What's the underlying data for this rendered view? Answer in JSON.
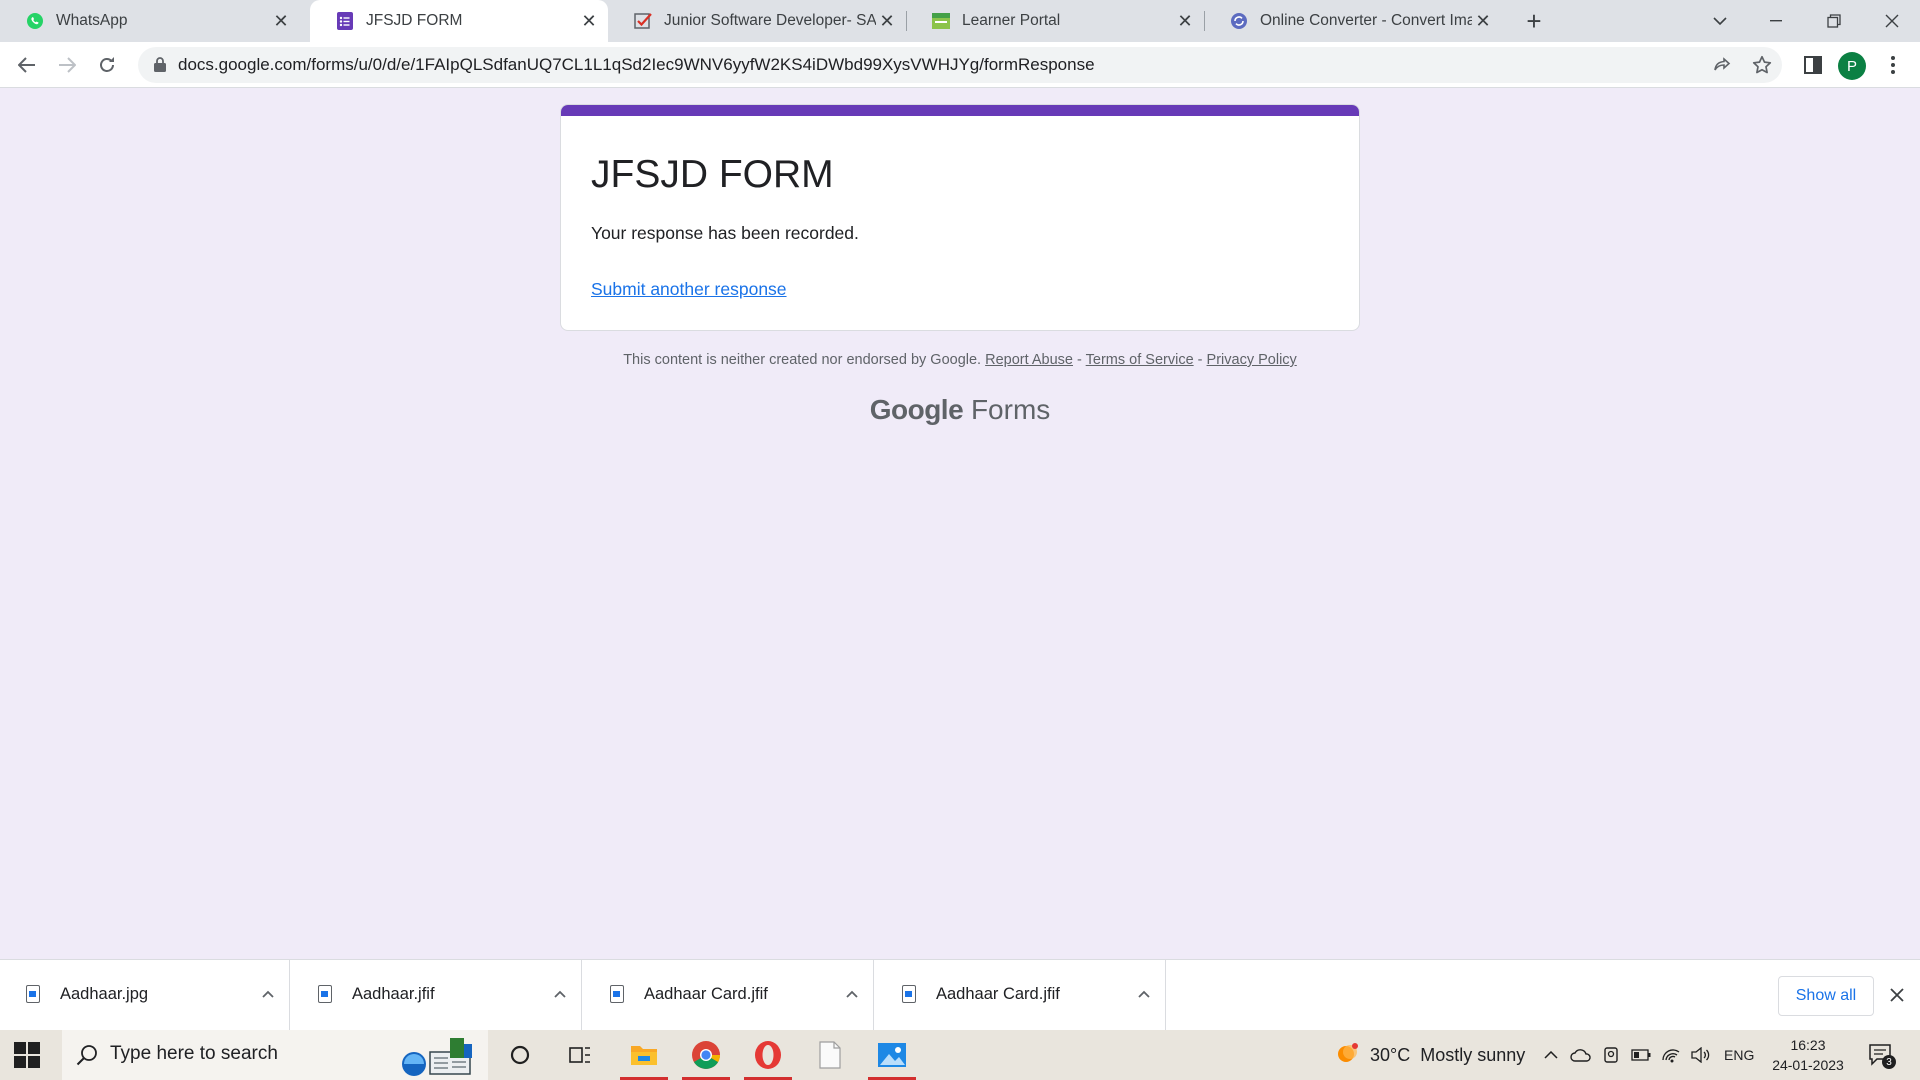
{
  "browser": {
    "tabs": [
      {
        "title": "WhatsApp",
        "favicon": "whatsapp-icon",
        "active": false
      },
      {
        "title": "JFSJD FORM",
        "favicon": "google-forms-icon",
        "active": true
      },
      {
        "title": "Junior Software Developer- SAT",
        "favicon": "checkmark-icon",
        "active": false
      },
      {
        "title": "Learner Portal",
        "favicon": "portal-icon",
        "active": false
      },
      {
        "title": "Online Converter - Convert Imag",
        "favicon": "converter-icon",
        "active": false
      }
    ],
    "url": "docs.google.com/forms/u/0/d/e/1FAIpQLSdfanUQ7CL1L1qSd2Iec9WNV6yyfW2KS4iDWbd99XysVWHJYg/formResponse",
    "profile_initial": "P",
    "colors": {
      "accent": "#673ab7",
      "link": "#1a73e8",
      "page_bg": "#f0ebf8",
      "profile": "#0b8043"
    }
  },
  "form": {
    "title": "JFSJD FORM",
    "message": "Your response has been recorded.",
    "submit_another": "Submit another response"
  },
  "footer": {
    "note": "This content is neither created nor endorsed by Google.",
    "report_abuse": "Report Abuse",
    "sep1": "-",
    "terms": "Terms of Service",
    "sep2": "-",
    "privacy": "Privacy Policy",
    "brand_google": "Google",
    "brand_forms": "Forms"
  },
  "downloads": {
    "items": [
      {
        "name": "Aadhaar.jpg"
      },
      {
        "name": "Aadhaar.jfif"
      },
      {
        "name": "Aadhaar Card.jfif"
      },
      {
        "name": "Aadhaar Card.jfif"
      }
    ],
    "show_all": "Show all"
  },
  "taskbar": {
    "search_placeholder": "Type here to search",
    "weather": "30°C  Mostly sunny",
    "language": "ENG",
    "time": "16:23",
    "date": "24-01-2023",
    "notification_count": "3"
  }
}
